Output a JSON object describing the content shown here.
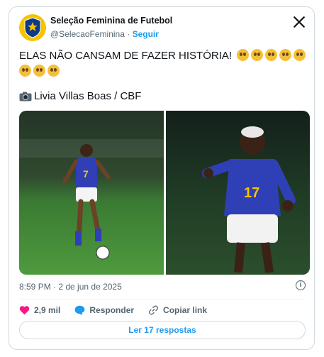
{
  "account": {
    "name": "Seleção Feminina de Futebol",
    "handle": "@SelecaoFeminina",
    "separator": "·",
    "follow_label": "Seguir",
    "avatar_text": "BRASIL"
  },
  "tweet": {
    "text": "ELAS NÃO CANSAM DE FAZER HISTÓRIA!",
    "emoji_count": 8,
    "photo_credit": "Livia Villas Boas / CBF",
    "timestamp": "8:59 PM · 2 de jun de 2025"
  },
  "photos": {
    "left_jersey_number": "7",
    "right_jersey_number": "17"
  },
  "actions": {
    "likes": "2,9 mil",
    "reply_label": "Responder",
    "copy_link_label": "Copiar link"
  },
  "replies_button": "Ler 17 respostas",
  "colors": {
    "brand_yellow": "#f4c400",
    "link_blue": "#1d9bf0",
    "like_pink": "#f91880",
    "jersey_blue": "#2f3fb5"
  }
}
